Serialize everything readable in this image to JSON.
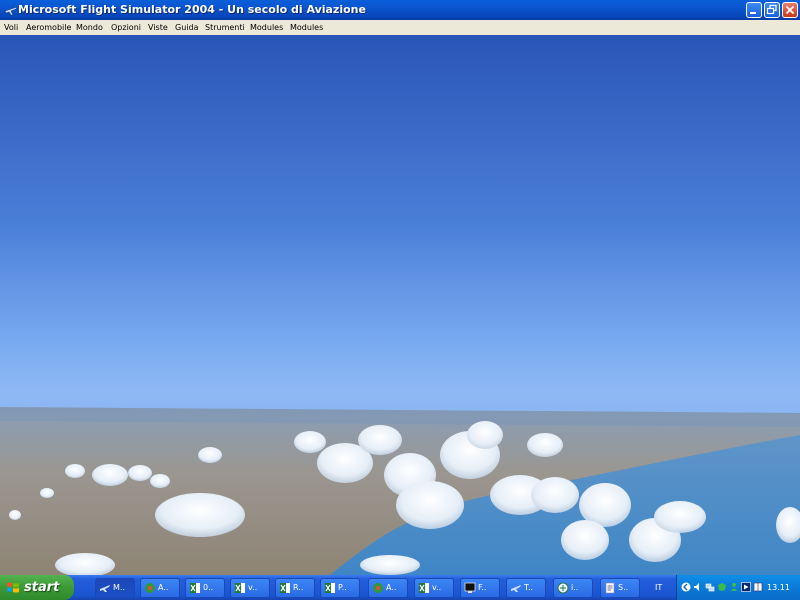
{
  "window": {
    "title": "Microsoft Flight Simulator 2004 - Un secolo di Aviazione"
  },
  "menu": {
    "items": [
      "Voli",
      "Aeromobile",
      "Mondo",
      "Opzioni",
      "Viste",
      "Guida",
      "Strumenti",
      "Modules",
      "Modules"
    ]
  },
  "taskbar": {
    "start_label": "start",
    "buttons": [
      {
        "label": "M..",
        "icon": "flight-sim-icon"
      },
      {
        "label": "A..",
        "icon": "app-icon"
      },
      {
        "label": "0..",
        "icon": "excel-icon"
      },
      {
        "label": "v..",
        "icon": "excel-icon"
      },
      {
        "label": "R..",
        "icon": "excel-icon"
      },
      {
        "label": "P..",
        "icon": "excel-icon"
      },
      {
        "label": "A..",
        "icon": "app-icon"
      },
      {
        "label": "v..",
        "icon": "excel-icon"
      },
      {
        "label": "F..",
        "icon": "monitor-icon"
      },
      {
        "label": "T..",
        "icon": "flight-sim-icon"
      },
      {
        "label": "i..",
        "icon": "browser-icon"
      },
      {
        "label": "S..",
        "icon": "document-icon"
      }
    ],
    "language": "IT",
    "clock": "13.11"
  },
  "colors": {
    "titlebar": "#0b55cf",
    "menubar": "#ece9d8",
    "taskbar": "#245edb",
    "start": "#3c9a36",
    "tray": "#0b7ad9"
  }
}
